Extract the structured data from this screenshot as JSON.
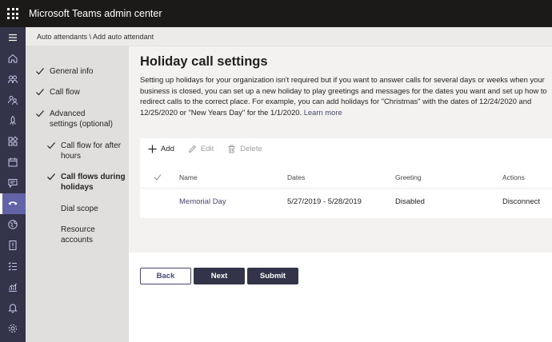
{
  "app": {
    "title": "Microsoft Teams admin center"
  },
  "breadcrumb": "Auto attendants \\ Add auto attendant",
  "rail": {
    "icons": [
      "menu-icon",
      "home-icon",
      "teams-icon",
      "users-icon",
      "deploy-icon",
      "apps-icon",
      "meetings-icon",
      "messaging-icon",
      "voice-icon",
      "locations-icon",
      "policy-icon",
      "planning-icon",
      "analytics-icon",
      "notifications-icon",
      "settings-icon"
    ],
    "active": "voice-icon"
  },
  "steps": [
    {
      "label": "General info",
      "checked": true
    },
    {
      "label": "Call flow",
      "checked": true
    },
    {
      "label": "Advanced settings (optional)",
      "checked": true
    },
    {
      "label": "Call flow for after hours",
      "checked": true
    },
    {
      "label": "Call flows during holidays",
      "checked": true,
      "current": true
    },
    {
      "label": "Dial scope",
      "checked": false
    },
    {
      "label": "Resource accounts",
      "checked": false
    }
  ],
  "main": {
    "title": "Holiday call settings",
    "description": "Setting up holidays for your organization isn't required but if you want to answer calls for several days or weeks when your business is closed, you can set up a new holiday to play greetings and messages for the dates you want and set up how to redirect calls to the correct place. For example, you can add holidays for \"Christmas\" with the dates of 12/24/2020 and 12/25/2020 or \"New Years Day\" for the 1/1/2020.",
    "learn_more": "Learn more"
  },
  "toolbar": {
    "add": "Add",
    "edit": "Edit",
    "delete": "Delete"
  },
  "table": {
    "headers": {
      "name": "Name",
      "dates": "Dates",
      "greeting": "Greeting",
      "actions": "Actions"
    },
    "rows": [
      {
        "name": "Memorial Day",
        "dates": "5/27/2019 - 5/28/2019",
        "greeting": "Disabled",
        "actions": "Disconnect"
      }
    ]
  },
  "buttons": {
    "back": "Back",
    "next": "Next",
    "submit": "Submit"
  },
  "colors": {
    "topbar": "#1b1a19",
    "rail": "#33344a",
    "accent": "#6264a7",
    "primary_button": "#33344a",
    "link": "#464775"
  }
}
